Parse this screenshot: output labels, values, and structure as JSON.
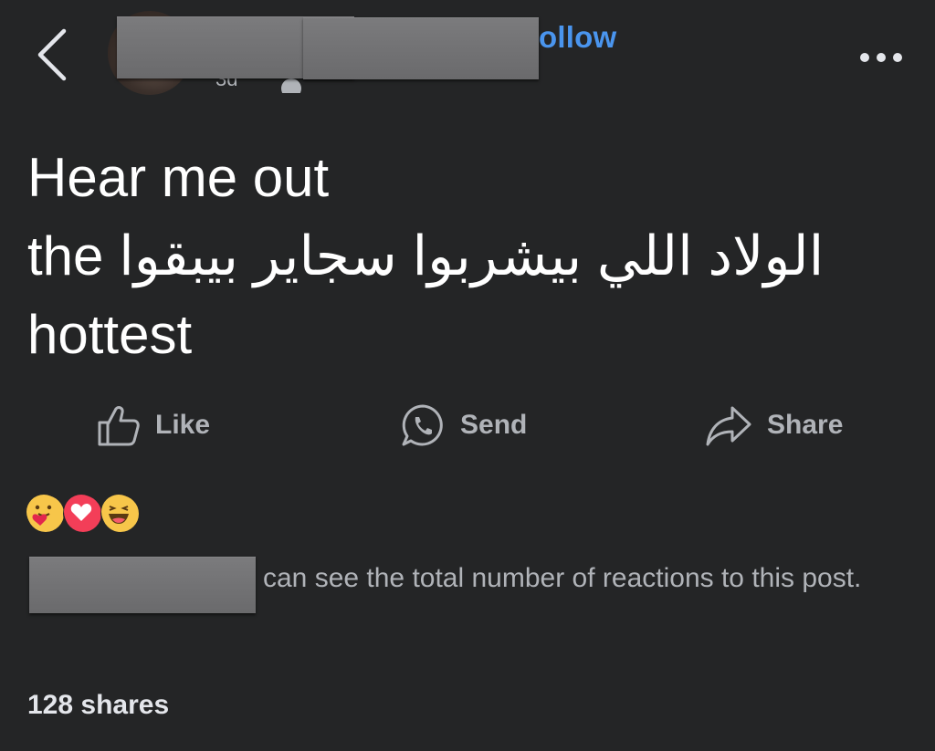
{
  "header": {
    "follow_label": "ollow",
    "time_fragment": "3d"
  },
  "post": {
    "lines": [
      "Hear me out",
      "الولاد اللي بيشربوا سجاير بيبقوا the",
      "hottest"
    ]
  },
  "actions": {
    "like_label": "Like",
    "send_label": "Send",
    "share_label": "Share"
  },
  "reactions": {
    "icons": [
      "hug-reaction",
      "love-reaction",
      "haha-reaction"
    ],
    "note": "can see the total number of reactions to this post."
  },
  "footer": {
    "shares_label": "128 shares"
  },
  "colors": {
    "background": "#242526",
    "accent": "#4a95ee",
    "secondary_text": "#b0b3b8"
  }
}
